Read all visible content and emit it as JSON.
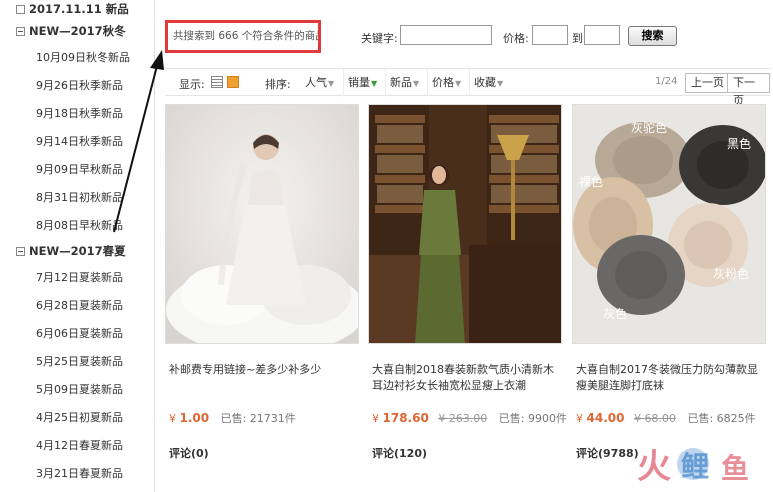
{
  "sidebar": {
    "group_top": {
      "label": "2017.11.11 新品"
    },
    "group_autumn": {
      "label": "NEW—2017秋冬"
    },
    "autumn_items": [
      "10月09日秋冬新品",
      "9月26日秋季新品",
      "9月18日秋季新品",
      "9月14日秋季新品",
      "9月09日早秋新品",
      "8月31日初秋新品",
      "8月08日早秋新品"
    ],
    "group_spring": {
      "label": "NEW—2017春夏"
    },
    "spring_items": [
      "7月12日夏装新品",
      "6月28日夏装新品",
      "6月06日夏装新品",
      "5月25日夏装新品",
      "5月09日夏装新品",
      "4月25日初夏新品",
      "4月12日春夏新品",
      "3月21日春夏新品"
    ]
  },
  "search": {
    "result_text": "共搜索到 666 个符合条件的商品",
    "keyword_label": "关键字:",
    "keyword_value": "",
    "price_label": "价格:",
    "price_min": "",
    "to_label": "到",
    "price_max": "",
    "button_label": "搜索"
  },
  "toolbar": {
    "display_label": "显示:",
    "sort_label": "排序:",
    "sorts": [
      "人气",
      "销量",
      "新品",
      "价格",
      "收藏"
    ],
    "page_indicator": "1/24",
    "prev_label": "上一页",
    "next_label": "下一页"
  },
  "products": [
    {
      "title": "补邮费专用链接~差多少补多少",
      "currency": "¥",
      "price": "1.00",
      "old_price": "",
      "sold": "已售: 21731件",
      "review": "评论(0)"
    },
    {
      "title": "大喜自制2018春装新款气质小清新木耳边衬衫女长袖宽松显瘦上衣潮",
      "currency": "¥",
      "price": "178.60",
      "old_price": "¥ 263.00",
      "sold": "已售: 9900件",
      "review": "评论(120)"
    },
    {
      "title": "大喜自制2017冬装微压力防勾薄款显瘦美腿连脚打底袜",
      "currency": "¥",
      "price": "44.00",
      "old_price": "¥ 68.00",
      "sold": "已售: 6825件",
      "review": "评论(9788)"
    }
  ],
  "image_labels": {
    "gray_ash": "灰驼色",
    "black": "黑色",
    "skin": "裸色",
    "gray_pink": "灰粉色",
    "gray": "灰色"
  },
  "colors": {
    "accent": "#e03a3a",
    "price": "#dd6633"
  }
}
